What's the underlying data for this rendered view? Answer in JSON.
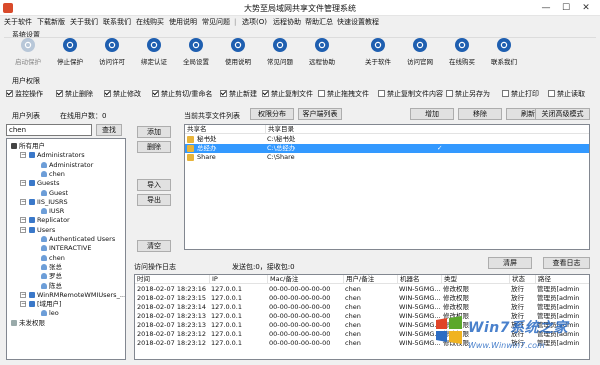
{
  "window": {
    "title": "大势至局域网共享文件管理系统",
    "minimize_glyph": "—",
    "maximize_glyph": "☐",
    "close_glyph": "✕"
  },
  "menu": [
    {
      "label": "关于软件"
    },
    {
      "label": "下载新版"
    },
    {
      "label": "关于我们"
    },
    {
      "label": "联系我们"
    },
    {
      "label": "在线购买"
    },
    {
      "label": "使用说明"
    },
    {
      "label": "常见问题"
    },
    {
      "label": "|"
    },
    {
      "label": "选项(O)"
    },
    {
      "label": "远程协助"
    },
    {
      "label": "帮助汇总"
    },
    {
      "label": "快速设置教程"
    }
  ],
  "system_settings": {
    "label": "系统设置",
    "tools": [
      {
        "label": "启动保护",
        "icon": "play-icon",
        "disabled": true
      },
      {
        "label": "停止保护",
        "icon": "pause-icon",
        "disabled": false
      },
      {
        "label": "访问许可",
        "icon": "key-icon",
        "disabled": false
      },
      {
        "label": "绑定认证",
        "icon": "link-icon",
        "disabled": false
      },
      {
        "label": "全局设置",
        "icon": "gear-icon",
        "disabled": false
      },
      {
        "label": "使用说明",
        "icon": "book-icon",
        "disabled": false
      },
      {
        "label": "常见问题",
        "icon": "question-icon",
        "disabled": false
      },
      {
        "label": "远程协助",
        "icon": "remote-icon",
        "disabled": false
      },
      {
        "label": "关于软件",
        "icon": "info-icon",
        "disabled": false
      },
      {
        "label": "访问官网",
        "icon": "globe-icon",
        "disabled": false
      },
      {
        "label": "在线购买",
        "icon": "cart-icon",
        "disabled": false
      },
      {
        "label": "联系我们",
        "icon": "contact-icon",
        "disabled": false
      }
    ]
  },
  "user_permissions": {
    "label": "用户权限",
    "checkboxes": [
      {
        "label": "监控操作",
        "checked": true
      },
      {
        "label": "禁止删除",
        "checked": true
      },
      {
        "label": "禁止修改",
        "checked": true
      },
      {
        "label": "禁止剪切/重命名",
        "checked": true
      },
      {
        "label": "禁止新建",
        "checked": true
      },
      {
        "label": "禁止复制文件",
        "checked": true
      },
      {
        "label": "禁止拖拽文件",
        "checked": false
      },
      {
        "label": "禁止复制文件内容",
        "checked": false
      },
      {
        "label": "禁止另存为",
        "checked": false
      },
      {
        "label": "禁止打印",
        "checked": false
      },
      {
        "label": "禁止读取",
        "checked": false
      }
    ]
  },
  "users": {
    "list_label": "用户列表",
    "online_label": "在线用户数：0",
    "search_value": "chen",
    "search_button": "查找",
    "add_button": "添加",
    "delete_button": "删除",
    "import_button": "导入",
    "export_button": "导出",
    "clear_button": "清空",
    "tree": [
      {
        "label": "所有用户",
        "kind": "root",
        "level": 0
      },
      {
        "label": "Administrators",
        "kind": "group",
        "level": 1
      },
      {
        "label": "Administrator",
        "kind": "user",
        "level": 2
      },
      {
        "label": "chen",
        "kind": "user",
        "level": 2
      },
      {
        "label": "Guests",
        "kind": "group",
        "level": 1
      },
      {
        "label": "Guest",
        "kind": "user",
        "level": 2
      },
      {
        "label": "IIS_IUSRS",
        "kind": "group",
        "level": 1
      },
      {
        "label": "IUSR",
        "kind": "user",
        "level": 2
      },
      {
        "label": "Replicator",
        "kind": "group",
        "level": 1
      },
      {
        "label": "Users",
        "kind": "group",
        "level": 1
      },
      {
        "label": "Authenticated Users",
        "kind": "user",
        "level": 2
      },
      {
        "label": "INTERACTIVE",
        "kind": "user",
        "level": 2
      },
      {
        "label": "chen",
        "kind": "user",
        "level": 2
      },
      {
        "label": "张总",
        "kind": "user",
        "level": 2
      },
      {
        "label": "罗总",
        "kind": "user",
        "level": 2
      },
      {
        "label": "陈总",
        "kind": "user",
        "level": 2
      },
      {
        "label": "WinRMRemoteWMIUsers_...",
        "kind": "group",
        "level": 1
      },
      {
        "label": "[域用户]",
        "kind": "group",
        "level": 1
      },
      {
        "label": "leo",
        "kind": "user",
        "level": 2
      },
      {
        "label": "未发权限",
        "kind": "other",
        "level": 0
      }
    ]
  },
  "shares": {
    "label": "当前共享文件列表",
    "permission_tab": "权限分布",
    "client_tab": "客户端列表",
    "add_button": "增加",
    "remove_button": "移除",
    "refresh_button": "刷新",
    "advanced_button": "关闭高级模式",
    "columns": [
      "共享名",
      "共享目录"
    ],
    "rows": [
      {
        "name": "秘书处",
        "dir": "C:\\秘书处",
        "selected": false,
        "check": ""
      },
      {
        "name": "总经办",
        "dir": "C:\\总经办",
        "selected": true,
        "check": "✓"
      },
      {
        "name": "Share",
        "dir": "C:\\Share",
        "selected": false,
        "check": ""
      }
    ]
  },
  "log": {
    "label": "访问操作日志",
    "stats": "发送包:0，接收包:0",
    "clear_button": "清屏",
    "view_button": "查看日志",
    "columns": [
      "时间",
      "IP",
      "Mac/备注",
      "用户/备注",
      "机器名",
      "类型",
      "状态",
      "路径"
    ],
    "rows": [
      [
        "2018-02-07 18:23:16",
        "127.0.0.1",
        "00-00-00-00-00-00",
        "chen",
        "WIN-5GMG...",
        "修改权限",
        "放行",
        "管理员[admin"
      ],
      [
        "2018-02-07 18:23:15",
        "127.0.0.1",
        "00-00-00-00-00-00",
        "chen",
        "WIN-5GMG...",
        "修改权限",
        "放行",
        "管理员[admin"
      ],
      [
        "2018-02-07 18:23:14",
        "127.0.0.1",
        "00-00-00-00-00-00",
        "chen",
        "WIN-5GMG...",
        "修改权限",
        "放行",
        "管理员[admin"
      ],
      [
        "2018-02-07 18:23:13",
        "127.0.0.1",
        "00-00-00-00-00-00",
        "chen",
        "WIN-5GMG...",
        "修改权限",
        "放行",
        "管理员[admin"
      ],
      [
        "2018-02-07 18:23:13",
        "127.0.0.1",
        "00-00-00-00-00-00",
        "chen",
        "WIN-5GMG...",
        "修改权限",
        "放行",
        "管理员[admin"
      ],
      [
        "2018-02-07 18:23:12",
        "127.0.0.1",
        "00-00-00-00-00-00",
        "chen",
        "WIN-5GMG...",
        "修改权限",
        "放行",
        "管理员[admin"
      ],
      [
        "2018-02-07 18:23:12",
        "127.0.0.1",
        "00-00-00-00-00-00",
        "chen",
        "WIN-5GMG...",
        "修改权限",
        "放行",
        "管理员[admin"
      ]
    ]
  },
  "watermark": {
    "brand": "Win7系统之家",
    "url": "Www.Winwin7.com"
  },
  "colors": {
    "accent": "#1f5fb0",
    "selection": "#3399ff",
    "watermark_blue": "#2b6cc4",
    "watermark_red": "#e04428"
  }
}
